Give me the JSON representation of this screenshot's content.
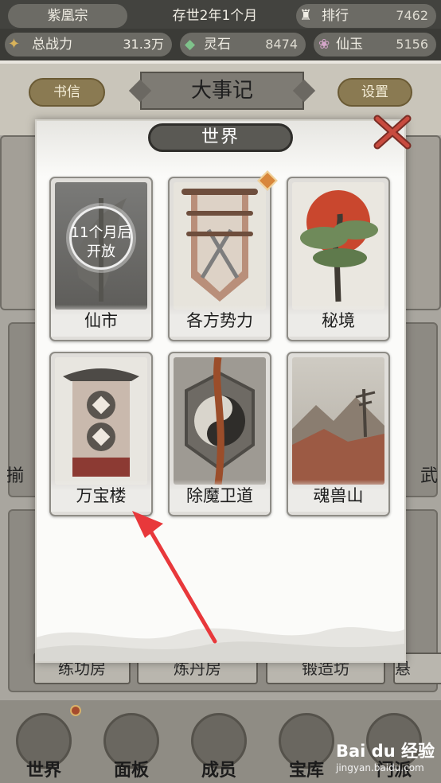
{
  "topbar": {
    "sect_name": "紫凰宗",
    "time": "存世2年1个月",
    "rank_label": "排行",
    "rank_value": "7462",
    "power_label": "总战力",
    "power_value": "31.3万",
    "stone_label": "灵石",
    "stone_value": "8474",
    "jade_label": "仙玉",
    "jade_value": "5156"
  },
  "header": {
    "left_button": "书信",
    "title": "大事记",
    "right_button": "设置"
  },
  "background": {
    "labels": [
      "练功房",
      "炼丹房",
      "锻造坊",
      "悬"
    ],
    "side_left": "揃",
    "side_right": "武"
  },
  "modal": {
    "title": "世界",
    "cards": [
      {
        "label": "仙市",
        "locked_text": "11个月后\n开放",
        "locked": true
      },
      {
        "label": "各方势力",
        "badge": true
      },
      {
        "label": "秘境"
      },
      {
        "label": "万宝楼"
      },
      {
        "label": "除魔卫道"
      },
      {
        "label": "魂兽山"
      }
    ]
  },
  "bottomnav": {
    "items": [
      {
        "label": "世界",
        "badge": true
      },
      {
        "label": "面板"
      },
      {
        "label": "成员"
      },
      {
        "label": "宝库"
      },
      {
        "label": "门派"
      }
    ]
  },
  "watermark": {
    "logo": "Bai du 经验",
    "url": "jingyan.baidu.com"
  },
  "colors": {
    "modal_title_bg": "#5a5954",
    "badge": "#d8873b",
    "arrow": "#e8383b",
    "close_x": "#c84b3f"
  }
}
